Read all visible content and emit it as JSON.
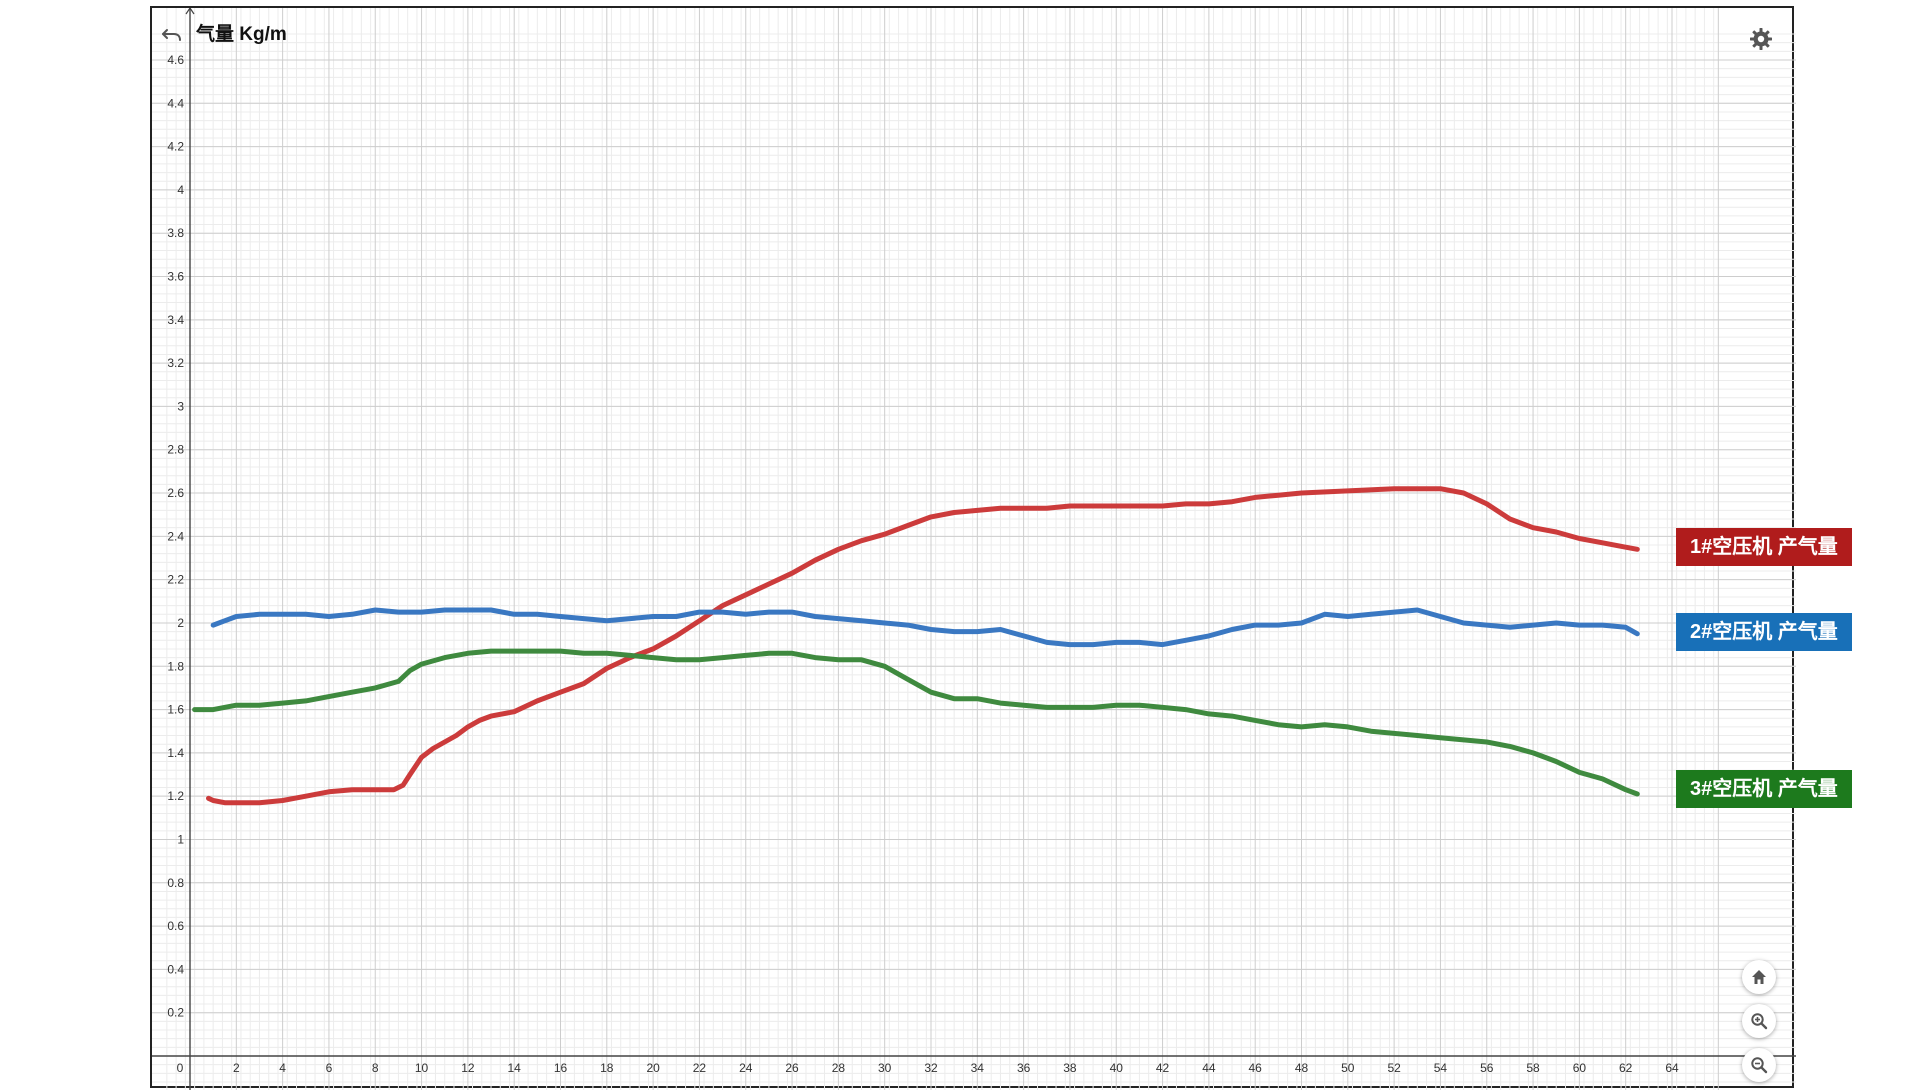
{
  "chart_data": {
    "type": "line",
    "title": "",
    "ylabel": "气量 Kg/m",
    "xlabel": "",
    "xlim": [
      -1,
      66
    ],
    "ylim": [
      -0.2,
      4.75
    ],
    "x_ticks": [
      0,
      2,
      4,
      6,
      8,
      10,
      12,
      14,
      16,
      18,
      20,
      22,
      24,
      26,
      28,
      30,
      32,
      34,
      36,
      38,
      40,
      42,
      44,
      46,
      48,
      50,
      52,
      54,
      56,
      58,
      60,
      62,
      64
    ],
    "y_ticks": [
      0.2,
      0.4,
      0.6,
      0.8,
      1,
      1.2,
      1.4,
      1.6,
      1.8,
      2,
      2.2,
      2.4,
      2.6,
      2.8,
      3,
      3.2,
      3.4,
      3.6,
      3.8,
      4,
      4.2,
      4.4,
      4.6
    ],
    "grid": true,
    "series": [
      {
        "name": "1#空压机 产气量",
        "color": "#cc3b3b",
        "points": [
          [
            0.8,
            1.19
          ],
          [
            1,
            1.18
          ],
          [
            1.5,
            1.17
          ],
          [
            2,
            1.17
          ],
          [
            3,
            1.17
          ],
          [
            4,
            1.18
          ],
          [
            5,
            1.2
          ],
          [
            6,
            1.22
          ],
          [
            7,
            1.23
          ],
          [
            8,
            1.23
          ],
          [
            8.8,
            1.23
          ],
          [
            9.2,
            1.25
          ],
          [
            9.5,
            1.3
          ],
          [
            10,
            1.38
          ],
          [
            10.5,
            1.42
          ],
          [
            11,
            1.45
          ],
          [
            11.5,
            1.48
          ],
          [
            12,
            1.52
          ],
          [
            12.5,
            1.55
          ],
          [
            13,
            1.57
          ],
          [
            14,
            1.59
          ],
          [
            15,
            1.64
          ],
          [
            16,
            1.68
          ],
          [
            17,
            1.72
          ],
          [
            18,
            1.79
          ],
          [
            19,
            1.84
          ],
          [
            20,
            1.88
          ],
          [
            21,
            1.94
          ],
          [
            22,
            2.01
          ],
          [
            23,
            2.08
          ],
          [
            24,
            2.13
          ],
          [
            25,
            2.18
          ],
          [
            26,
            2.23
          ],
          [
            27,
            2.29
          ],
          [
            28,
            2.34
          ],
          [
            29,
            2.38
          ],
          [
            30,
            2.41
          ],
          [
            31,
            2.45
          ],
          [
            32,
            2.49
          ],
          [
            33,
            2.51
          ],
          [
            34,
            2.52
          ],
          [
            35,
            2.53
          ],
          [
            36,
            2.53
          ],
          [
            37,
            2.53
          ],
          [
            38,
            2.54
          ],
          [
            40,
            2.54
          ],
          [
            42,
            2.54
          ],
          [
            43,
            2.55
          ],
          [
            44,
            2.55
          ],
          [
            45,
            2.56
          ],
          [
            46,
            2.58
          ],
          [
            47,
            2.59
          ],
          [
            48,
            2.6
          ],
          [
            50,
            2.61
          ],
          [
            52,
            2.62
          ],
          [
            53,
            2.62
          ],
          [
            54,
            2.62
          ],
          [
            55,
            2.6
          ],
          [
            56,
            2.55
          ],
          [
            57,
            2.48
          ],
          [
            58,
            2.44
          ],
          [
            59,
            2.42
          ],
          [
            60,
            2.39
          ],
          [
            61,
            2.37
          ],
          [
            62,
            2.35
          ],
          [
            62.5,
            2.34
          ]
        ]
      },
      {
        "name": "2#空压机 产气量",
        "color": "#3a78c2",
        "points": [
          [
            1,
            1.99
          ],
          [
            1.5,
            2.01
          ],
          [
            2,
            2.03
          ],
          [
            3,
            2.04
          ],
          [
            4,
            2.04
          ],
          [
            5,
            2.04
          ],
          [
            6,
            2.03
          ],
          [
            7,
            2.04
          ],
          [
            8,
            2.06
          ],
          [
            9,
            2.05
          ],
          [
            10,
            2.05
          ],
          [
            11,
            2.06
          ],
          [
            12,
            2.06
          ],
          [
            13,
            2.06
          ],
          [
            14,
            2.04
          ],
          [
            15,
            2.04
          ],
          [
            16,
            2.03
          ],
          [
            17,
            2.02
          ],
          [
            18,
            2.01
          ],
          [
            19,
            2.02
          ],
          [
            20,
            2.03
          ],
          [
            21,
            2.03
          ],
          [
            22,
            2.05
          ],
          [
            23,
            2.05
          ],
          [
            24,
            2.04
          ],
          [
            25,
            2.05
          ],
          [
            26,
            2.05
          ],
          [
            27,
            2.03
          ],
          [
            28,
            2.02
          ],
          [
            29,
            2.01
          ],
          [
            30,
            2.0
          ],
          [
            31,
            1.99
          ],
          [
            32,
            1.97
          ],
          [
            33,
            1.96
          ],
          [
            34,
            1.96
          ],
          [
            35,
            1.97
          ],
          [
            36,
            1.94
          ],
          [
            37,
            1.91
          ],
          [
            38,
            1.9
          ],
          [
            39,
            1.9
          ],
          [
            40,
            1.91
          ],
          [
            41,
            1.91
          ],
          [
            42,
            1.9
          ],
          [
            43,
            1.92
          ],
          [
            44,
            1.94
          ],
          [
            45,
            1.97
          ],
          [
            46,
            1.99
          ],
          [
            47,
            1.99
          ],
          [
            48,
            2.0
          ],
          [
            49,
            2.04
          ],
          [
            50,
            2.03
          ],
          [
            51,
            2.04
          ],
          [
            52,
            2.05
          ],
          [
            53,
            2.06
          ],
          [
            54,
            2.03
          ],
          [
            55,
            2.0
          ],
          [
            56,
            1.99
          ],
          [
            57,
            1.98
          ],
          [
            58,
            1.99
          ],
          [
            59,
            2.0
          ],
          [
            60,
            1.99
          ],
          [
            61,
            1.99
          ],
          [
            62,
            1.98
          ],
          [
            62.5,
            1.95
          ]
        ]
      },
      {
        "name": "3#空压机 产气量",
        "color": "#3f8a3f",
        "points": [
          [
            0.2,
            1.6
          ],
          [
            1,
            1.6
          ],
          [
            2,
            1.62
          ],
          [
            3,
            1.62
          ],
          [
            4,
            1.63
          ],
          [
            5,
            1.64
          ],
          [
            6,
            1.66
          ],
          [
            7,
            1.68
          ],
          [
            8,
            1.7
          ],
          [
            9,
            1.73
          ],
          [
            9.5,
            1.78
          ],
          [
            10,
            1.81
          ],
          [
            11,
            1.84
          ],
          [
            12,
            1.86
          ],
          [
            13,
            1.87
          ],
          [
            14,
            1.87
          ],
          [
            15,
            1.87
          ],
          [
            16,
            1.87
          ],
          [
            17,
            1.86
          ],
          [
            18,
            1.86
          ],
          [
            19,
            1.85
          ],
          [
            20,
            1.84
          ],
          [
            21,
            1.83
          ],
          [
            22,
            1.83
          ],
          [
            23,
            1.84
          ],
          [
            24,
            1.85
          ],
          [
            25,
            1.86
          ],
          [
            26,
            1.86
          ],
          [
            27,
            1.84
          ],
          [
            28,
            1.83
          ],
          [
            29,
            1.83
          ],
          [
            30,
            1.8
          ],
          [
            31,
            1.74
          ],
          [
            32,
            1.68
          ],
          [
            33,
            1.65
          ],
          [
            34,
            1.65
          ],
          [
            35,
            1.63
          ],
          [
            36,
            1.62
          ],
          [
            37,
            1.61
          ],
          [
            38,
            1.61
          ],
          [
            39,
            1.61
          ],
          [
            40,
            1.62
          ],
          [
            41,
            1.62
          ],
          [
            42,
            1.61
          ],
          [
            43,
            1.6
          ],
          [
            44,
            1.58
          ],
          [
            45,
            1.57
          ],
          [
            46,
            1.55
          ],
          [
            47,
            1.53
          ],
          [
            48,
            1.52
          ],
          [
            49,
            1.53
          ],
          [
            50,
            1.52
          ],
          [
            51,
            1.5
          ],
          [
            52,
            1.49
          ],
          [
            53,
            1.48
          ],
          [
            54,
            1.47
          ],
          [
            55,
            1.46
          ],
          [
            56,
            1.45
          ],
          [
            57,
            1.43
          ],
          [
            58,
            1.4
          ],
          [
            59,
            1.36
          ],
          [
            60,
            1.31
          ],
          [
            61,
            1.28
          ],
          [
            62,
            1.23
          ],
          [
            62.5,
            1.21
          ]
        ]
      }
    ]
  },
  "legend": [
    {
      "label": "1#空压机 产气量",
      "color": "#b01c1c"
    },
    {
      "label": "2#空压机 产气量",
      "color": "#1870b8"
    },
    {
      "label": "3#空压机 产气量",
      "color": "#1d7a1d"
    }
  ],
  "toolbar": {
    "undo_icon": "undo-arrow",
    "settings_icon": "gear",
    "home_icon": "home",
    "zoom_in_icon": "magnifier-plus",
    "zoom_out_icon": "magnifier-minus"
  }
}
